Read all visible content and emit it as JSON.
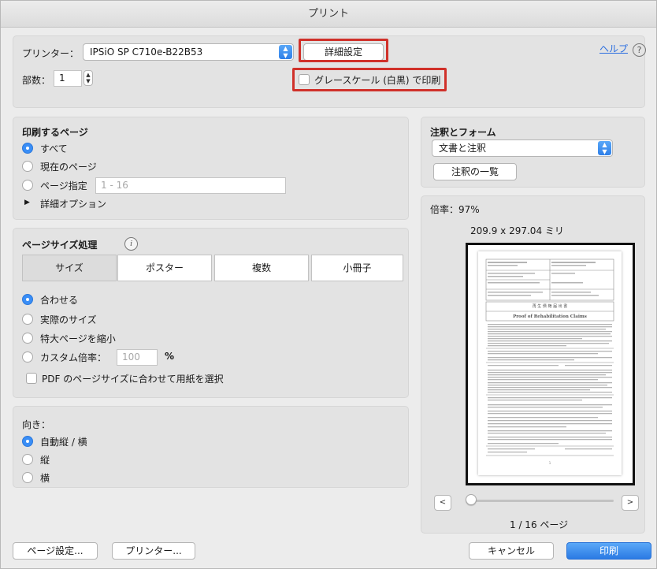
{
  "window": {
    "title": "プリント"
  },
  "printer": {
    "label": "プリンター：",
    "value": "IPSiO SP C710e-B22B53"
  },
  "details_button": "詳細設定",
  "help_link": "ヘルプ",
  "help_icon": "?",
  "copies": {
    "label": "部数：",
    "value": "1"
  },
  "grayscale": {
    "label": "グレースケール (白黒) で印刷",
    "checked": false
  },
  "pages": {
    "title": "印刷するページ",
    "options": [
      "すべて",
      "現在のページ",
      "ページ指定"
    ],
    "selected": "すべて",
    "range_placeholder": "1 - 16",
    "advanced": "詳細オプション",
    "advanced_icon": "disclosure-triangle-right"
  },
  "page_size": {
    "title": "ページサイズ処理",
    "info_icon": "i",
    "tabs": [
      "サイズ",
      "ポスター",
      "複数",
      "小冊子"
    ],
    "selected_tab": "サイズ",
    "options": [
      "合わせる",
      "実際のサイズ",
      "特大ページを縮小",
      "カスタム倍率："
    ],
    "selected": "合わせる",
    "custom_placeholder": "100",
    "percent": "%",
    "pdf_fit": "PDF のページサイズに合わせて用紙を選択"
  },
  "orientation": {
    "title": "向き：",
    "options": [
      "自動縦 / 横",
      "縦",
      "横"
    ],
    "selected": "自動縦 / 横"
  },
  "annotations": {
    "title": "注釈とフォーム",
    "value": "文書と注釈",
    "list_button": "注釈の一覧"
  },
  "preview": {
    "scale_label": "倍率：",
    "scale_value": "97%",
    "dimensions": "209.9 x 297.04 ミリ",
    "page_indicator": "1 / 16 ページ",
    "prev": "<",
    "next": ">",
    "document_title": "再 生 債 権 届 出 書",
    "document_subtitle": "Proof of Rehabilitation Claims",
    "page_number": "1"
  },
  "footer": {
    "page_setup": "ページ設定...",
    "printer": "プリンター...",
    "cancel": "キャンセル",
    "print": "印刷"
  },
  "colors": {
    "accent": "#3a8ef6",
    "highlight": "#d0312a",
    "link": "#2a6ee0"
  }
}
